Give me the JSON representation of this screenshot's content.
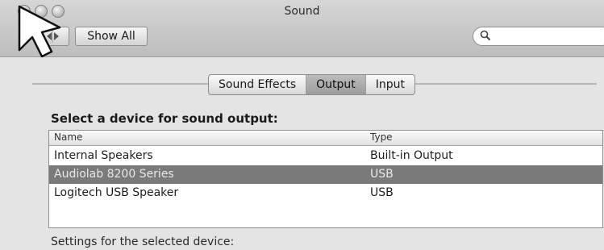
{
  "window": {
    "title": "Sound"
  },
  "toolbar": {
    "show_all_label": "Show All",
    "search_placeholder": ""
  },
  "tabs": [
    {
      "label": "Sound Effects",
      "selected": false
    },
    {
      "label": "Output",
      "selected": true
    },
    {
      "label": "Input",
      "selected": false
    }
  ],
  "output": {
    "heading": "Select a device for sound output:",
    "columns": {
      "name": "Name",
      "type": "Type"
    },
    "devices": [
      {
        "name": "Internal Speakers",
        "type": "Built-in Output",
        "selected": false
      },
      {
        "name": "Audiolab 8200 Series",
        "type": "USB",
        "selected": true
      },
      {
        "name": "Logitech USB Speaker",
        "type": "USB",
        "selected": false
      }
    ],
    "settings_label": "Settings for the selected device:"
  },
  "icons": {
    "pointer": "arrow-pointer-icon",
    "search": "search-icon",
    "back": "back-forward-icon"
  }
}
